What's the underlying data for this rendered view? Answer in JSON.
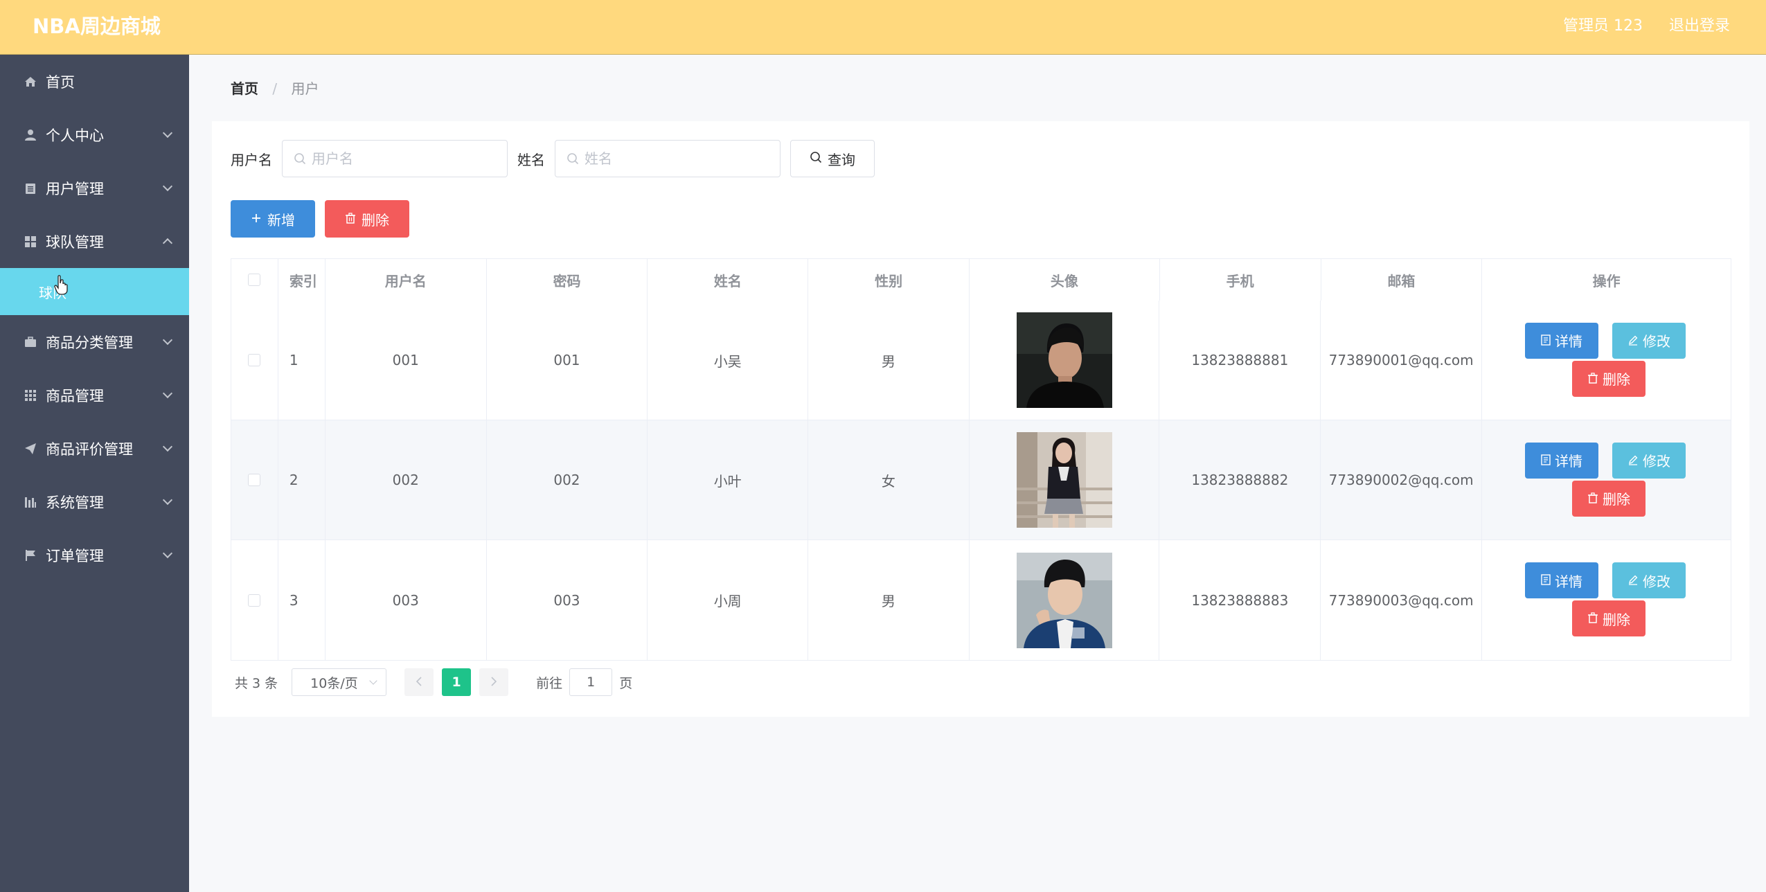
{
  "header": {
    "logo": "NBA周边商城",
    "user": "管理员 123",
    "logout": "退出登录"
  },
  "sidebar": {
    "items": [
      {
        "label": "首页",
        "icon": "home-icon"
      },
      {
        "label": "个人中心",
        "icon": "user-icon"
      },
      {
        "label": "用户管理",
        "icon": "clipboard-icon"
      },
      {
        "label": "球队管理",
        "icon": "grid-icon"
      },
      {
        "label": "商品分类管理",
        "icon": "briefcase-icon"
      },
      {
        "label": "商品管理",
        "icon": "apps-icon"
      },
      {
        "label": "商品评价管理",
        "icon": "send-icon"
      },
      {
        "label": "系统管理",
        "icon": "chart-icon"
      },
      {
        "label": "订单管理",
        "icon": "flag-icon"
      }
    ],
    "active_sub": "球队"
  },
  "breadcrumb": {
    "home": "首页",
    "separator": "/",
    "current": "用户"
  },
  "search": {
    "username_label": "用户名",
    "username_placeholder": "用户名",
    "name_label": "姓名",
    "name_placeholder": "姓名",
    "query_button": "查询"
  },
  "actions": {
    "add": "新增",
    "delete": "删除"
  },
  "table": {
    "headers": [
      "索引",
      "用户名",
      "密码",
      "姓名",
      "性别",
      "头像",
      "手机",
      "邮箱",
      "操作"
    ],
    "rows": [
      {
        "index": "1",
        "username": "001",
        "password": "001",
        "name": "小吴",
        "sex": "男",
        "phone": "13823888881",
        "email": "773890001@qq.com"
      },
      {
        "index": "2",
        "username": "002",
        "password": "002",
        "name": "小叶",
        "sex": "女",
        "phone": "13823888882",
        "email": "773890002@qq.com"
      },
      {
        "index": "3",
        "username": "003",
        "password": "003",
        "name": "小周",
        "sex": "男",
        "phone": "13823888883",
        "email": "773890003@qq.com"
      }
    ],
    "op_detail": "详情",
    "op_edit": "修改",
    "op_delete": "删除"
  },
  "pagination": {
    "total": "共 3 条",
    "page_size": "10条/页",
    "current_page": "1",
    "goto_prefix": "前往",
    "goto_value": "1",
    "goto_suffix": "页"
  },
  "colors": {
    "header": "#ffd97e",
    "sidebar": "#434a5c",
    "active_sub": "#68d7ed",
    "primary": "#3e8ddb",
    "danger": "#f35b5b",
    "info": "#5bc0de",
    "page_active": "#1ec38a"
  }
}
